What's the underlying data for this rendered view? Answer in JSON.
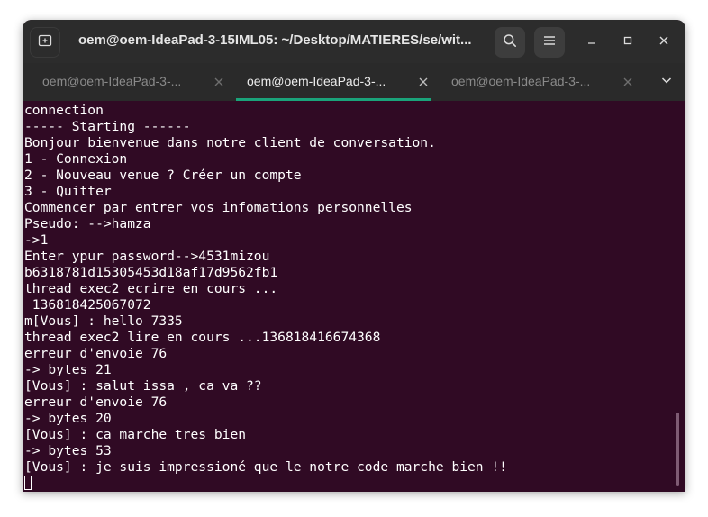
{
  "window": {
    "title": "oem@oem-IdeaPad-3-15IML05: ~/Desktop/MATIERES/se/wit..."
  },
  "icons": {
    "new_tab": "new-tab-icon",
    "search": "search-icon",
    "menu": "hamburger-menu-icon",
    "minimize": "minimize-icon",
    "maximize": "maximize-icon",
    "close": "close-icon",
    "tab_close": "close-icon",
    "tabs_dropdown": "chevron-down-icon"
  },
  "colors": {
    "terminal_bg": "#300a24",
    "titlebar_bg": "#2c2c2c",
    "active_tab_accent": "#1aa37a",
    "text": "#ffffff"
  },
  "tabs": [
    {
      "label": "oem@oem-IdeaPad-3-...",
      "active": false
    },
    {
      "label": "oem@oem-IdeaPad-3-...",
      "active": true
    },
    {
      "label": "oem@oem-IdeaPad-3-...",
      "active": false
    }
  ],
  "terminal": {
    "lines": [
      "connection",
      "----- Starting ------",
      "Bonjour bienvenue dans notre client de conversation.",
      "1 - Connexion",
      "2 - Nouveau venue ? Créer un compte",
      "3 - Quitter",
      "Commencer par entrer vos infomations personnelles",
      "Pseudo: -->hamza",
      "->1",
      "Enter ypur password-->4531mizou",
      "b6318781d15305453d18af17d9562fb1",
      "thread exec2 ecrire en cours ...",
      " 136818425067072",
      "m[Vous] : hello 7335",
      "thread exec2 lire en cours ...136818416674368",
      "erreur d'envoie 76",
      "-> bytes 21",
      "[Vous] : salut issa , ca va ??",
      "erreur d'envoie 76",
      "-> bytes 20",
      "[Vous] : ca marche tres bien",
      "-> bytes 53",
      "[Vous] : je suis impressioné que le notre code marche bien !!"
    ]
  }
}
